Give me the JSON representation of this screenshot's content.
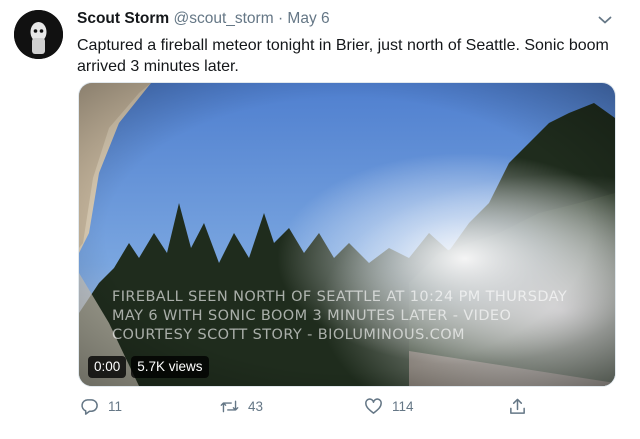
{
  "tweet": {
    "author_name": "Scout Storm",
    "handle": "@scout_storm",
    "separator": "·",
    "date": "May 6",
    "text": "Captured a fireball meteor tonight in Brier, just north of Seattle. Sonic boom arrived 3 minutes later.",
    "media": {
      "caption_line1": "FIREBALL SEEN NORTH OF SEATTLE AT 10:24 PM THURSDAY",
      "caption_line2": "MAY 6 WITH SONIC BOOM 3 MINUTES LATER - VIDEO",
      "caption_line3": "COURTESY SCOTT STORY - BIOLUMINOUS.COM",
      "time": "0:00",
      "views": "5.7K views"
    },
    "actions": {
      "replies": "11",
      "retweets": "43",
      "likes": "114"
    }
  },
  "icons": {
    "more": "chevron-down-icon",
    "reply": "reply-icon",
    "retweet": "retweet-icon",
    "like": "heart-icon",
    "share": "share-icon"
  },
  "colors": {
    "text": "#14171a",
    "secondary": "#657786",
    "sky": "#5f8fd8",
    "trees": "#1f2c1d"
  }
}
